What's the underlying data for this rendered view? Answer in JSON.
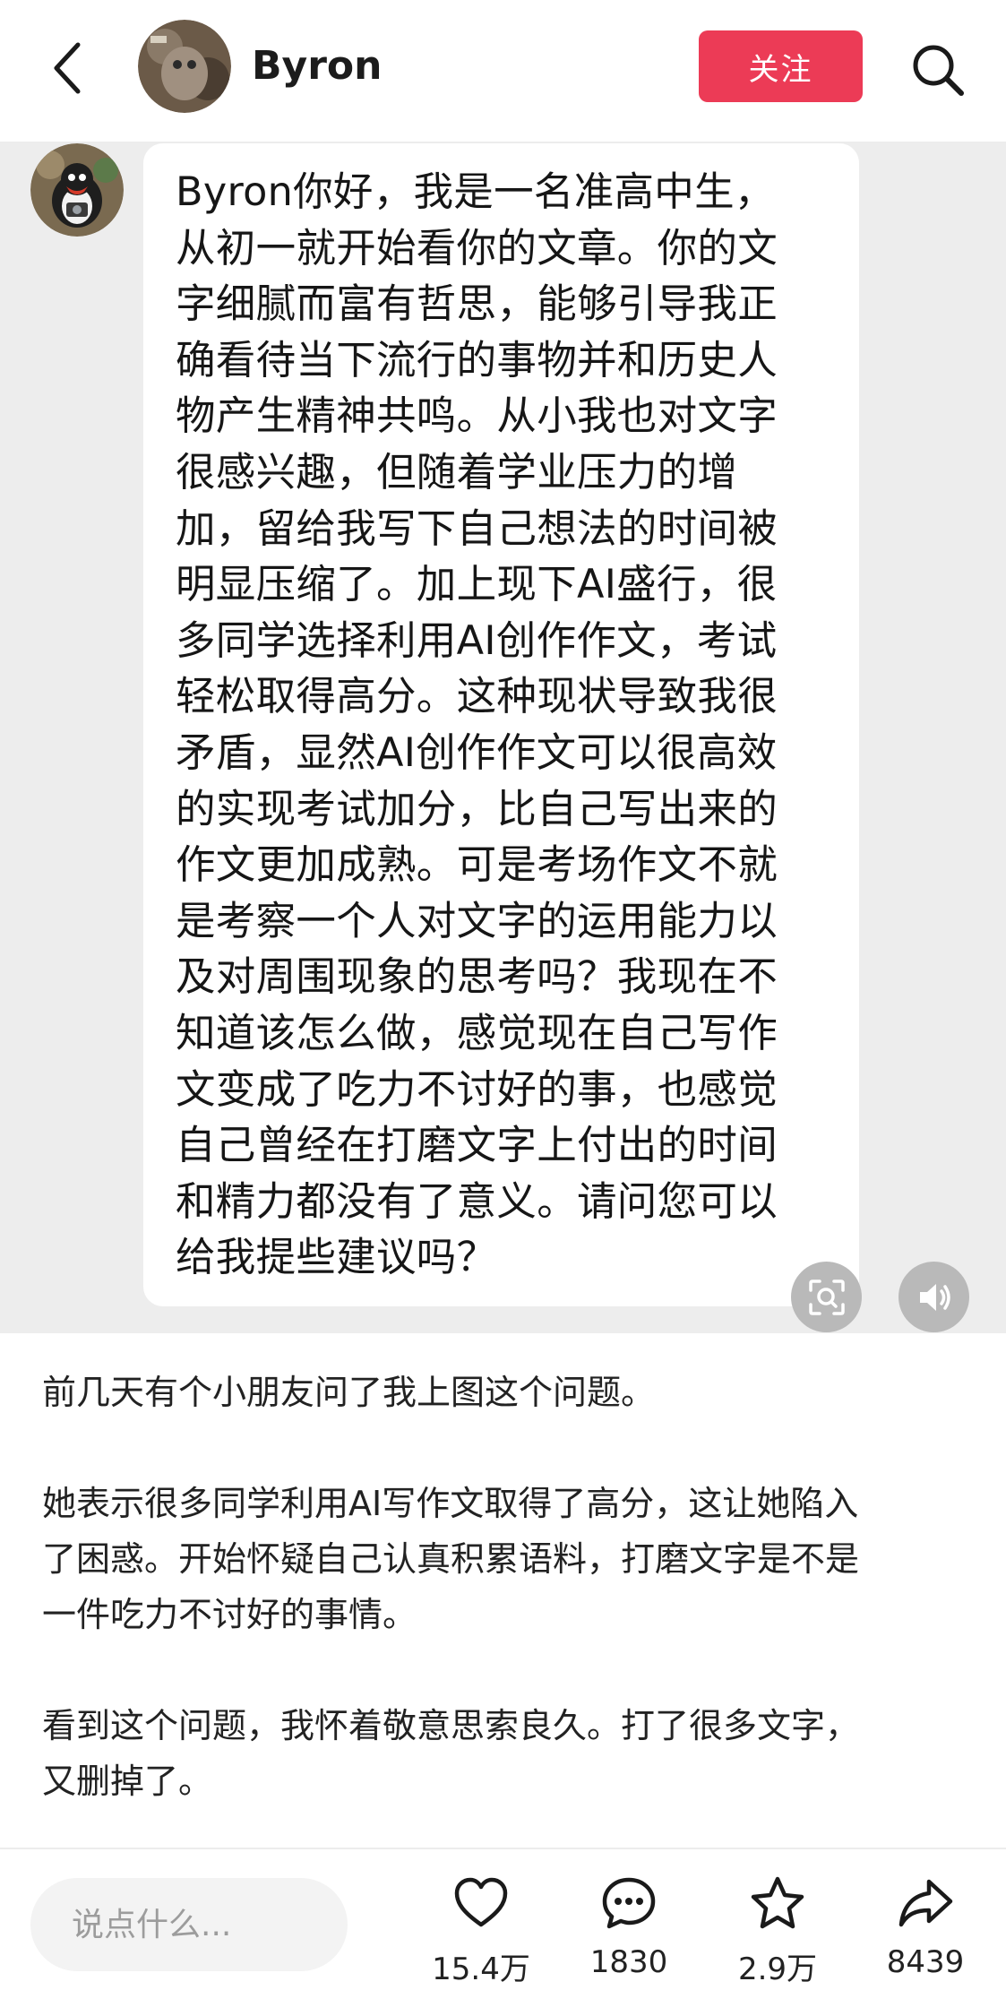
{
  "header": {
    "author_name": "Byron",
    "follow_label": "关注",
    "icons": {
      "back": "chevron-left-icon",
      "search": "search-icon"
    }
  },
  "image": {
    "message_lines": [
      "Byron你好，我是一名准高中生，",
      "从初一就开始看你的文章。你的文",
      "字细腻而富有哲思，能够引导我正",
      "确看待当下流行的事物并和历史人",
      "物产生精神共鸣。从小我也对文字",
      "很感兴趣，但随着学业压力的增",
      "加，留给我写下自己想法的时间被",
      "明显压缩了。加上现下AI盛行，很",
      "多同学选择利用AI创作作文，考试",
      "轻松取得高分。这种现状导致我很",
      "矛盾，显然AI创作作文可以很高效",
      "的实现考试加分，比自己写出来的",
      "作文更加成熟。可是考场作文不就",
      "是考察一个人对文字的运用能力以",
      "及对周围现象的思考吗？我现在不",
      "知道该怎么做，感觉现在自己写作",
      "文变成了吃力不讨好的事，也感觉",
      "自己曾经在打磨文字上付出的时间",
      "和精力都没有了意义。请问您可以",
      "给我提些建议吗？"
    ],
    "icons": {
      "ocr": "scan-text-icon",
      "speaker": "speaker-icon"
    }
  },
  "post": {
    "paragraphs": [
      "前几天有个小朋友问了我上图这个问题。",
      "",
      "她表示很多同学利用AI写作文取得了高分，这让她陷入",
      "了困惑。开始怀疑自己认真积累语料，打磨文字是不是",
      "一件吃力不讨好的事情。",
      "",
      "看到这个问题，我怀着敬意思索良久。打了很多文字，",
      "又删掉了。"
    ]
  },
  "bottom_bar": {
    "comment_placeholder": "说点什么...",
    "actions": [
      {
        "icon": "heart-icon",
        "count": "15.4万"
      },
      {
        "icon": "comment-icon",
        "count": "1830"
      },
      {
        "icon": "star-icon",
        "count": "2.9万"
      },
      {
        "icon": "share-icon",
        "count": "8439"
      }
    ]
  },
  "colors": {
    "follow_button": "#ec3b56",
    "image_background": "#ededed",
    "bubble": "#ffffff",
    "floating_buttons": "#b9b9b9"
  }
}
